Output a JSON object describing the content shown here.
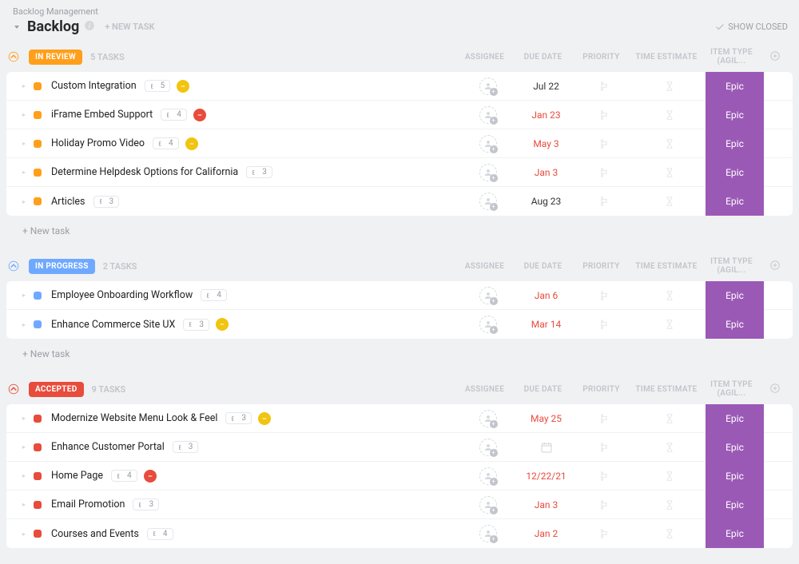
{
  "breadcrumb": "Backlog Management",
  "title": "Backlog",
  "new_task_button": "+ NEW TASK",
  "show_closed": "SHOW CLOSED",
  "columns": {
    "assignee": "ASSIGNEE",
    "due_date": "DUE DATE",
    "priority": "PRIORITY",
    "time_estimate": "TIME ESTIMATE",
    "item_type": "ITEM TYPE (AGIL..."
  },
  "new_task_label": "+ New task",
  "sections": [
    {
      "id": "in_review",
      "label": "IN REVIEW",
      "count": "5 TASKS",
      "color": "#ff9f1a",
      "tasks": [
        {
          "title": "Custom Integration",
          "sub": "5",
          "status": "#f1c40f",
          "due": "Jul 22",
          "due_red": false,
          "item": "Epic"
        },
        {
          "title": "iFrame Embed Support",
          "sub": "4",
          "status": "#e74c3c",
          "due": "Jan 23",
          "due_red": true,
          "item": "Epic"
        },
        {
          "title": "Holiday Promo Video",
          "sub": "4",
          "status": "#f1c40f",
          "due": "May 3",
          "due_red": true,
          "item": "Epic"
        },
        {
          "title": "Determine Helpdesk Options for California",
          "sub": "3",
          "status": "",
          "due": "Jan 3",
          "due_red": true,
          "item": "Epic"
        },
        {
          "title": "Articles",
          "sub": "3",
          "status": "",
          "due": "Aug 23",
          "due_red": false,
          "item": "Epic"
        }
      ]
    },
    {
      "id": "in_progress",
      "label": "IN PROGRESS",
      "count": "2 TASKS",
      "color": "#6fa8ff",
      "tasks": [
        {
          "title": "Employee Onboarding Workflow",
          "sub": "4",
          "status": "",
          "due": "Jan 6",
          "due_red": true,
          "item": "Epic"
        },
        {
          "title": "Enhance Commerce Site UX",
          "sub": "3",
          "status": "#f1c40f",
          "due": "Mar 14",
          "due_red": true,
          "item": "Epic"
        }
      ]
    },
    {
      "id": "accepted",
      "label": "ACCEPTED",
      "count": "9 TASKS",
      "color": "#e74c3c",
      "tasks": [
        {
          "title": "Modernize Website Menu Look & Feel",
          "sub": "3",
          "status": "#f1c40f",
          "due": "May 25",
          "due_red": true,
          "item": "Epic"
        },
        {
          "title": "Enhance Customer Portal",
          "sub": "3",
          "status": "",
          "due": "CAL",
          "due_red": false,
          "item": "Epic"
        },
        {
          "title": "Home Page",
          "sub": "4",
          "status": "#e74c3c",
          "due": "12/22/21",
          "due_red": true,
          "item": "Epic"
        },
        {
          "title": "Email Promotion",
          "sub": "3",
          "status": "",
          "due": "Jan 3",
          "due_red": true,
          "item": "Epic"
        },
        {
          "title": "Courses and Events",
          "sub": "4",
          "status": "",
          "due": "Jan 2",
          "due_red": true,
          "item": "Epic"
        }
      ]
    }
  ]
}
